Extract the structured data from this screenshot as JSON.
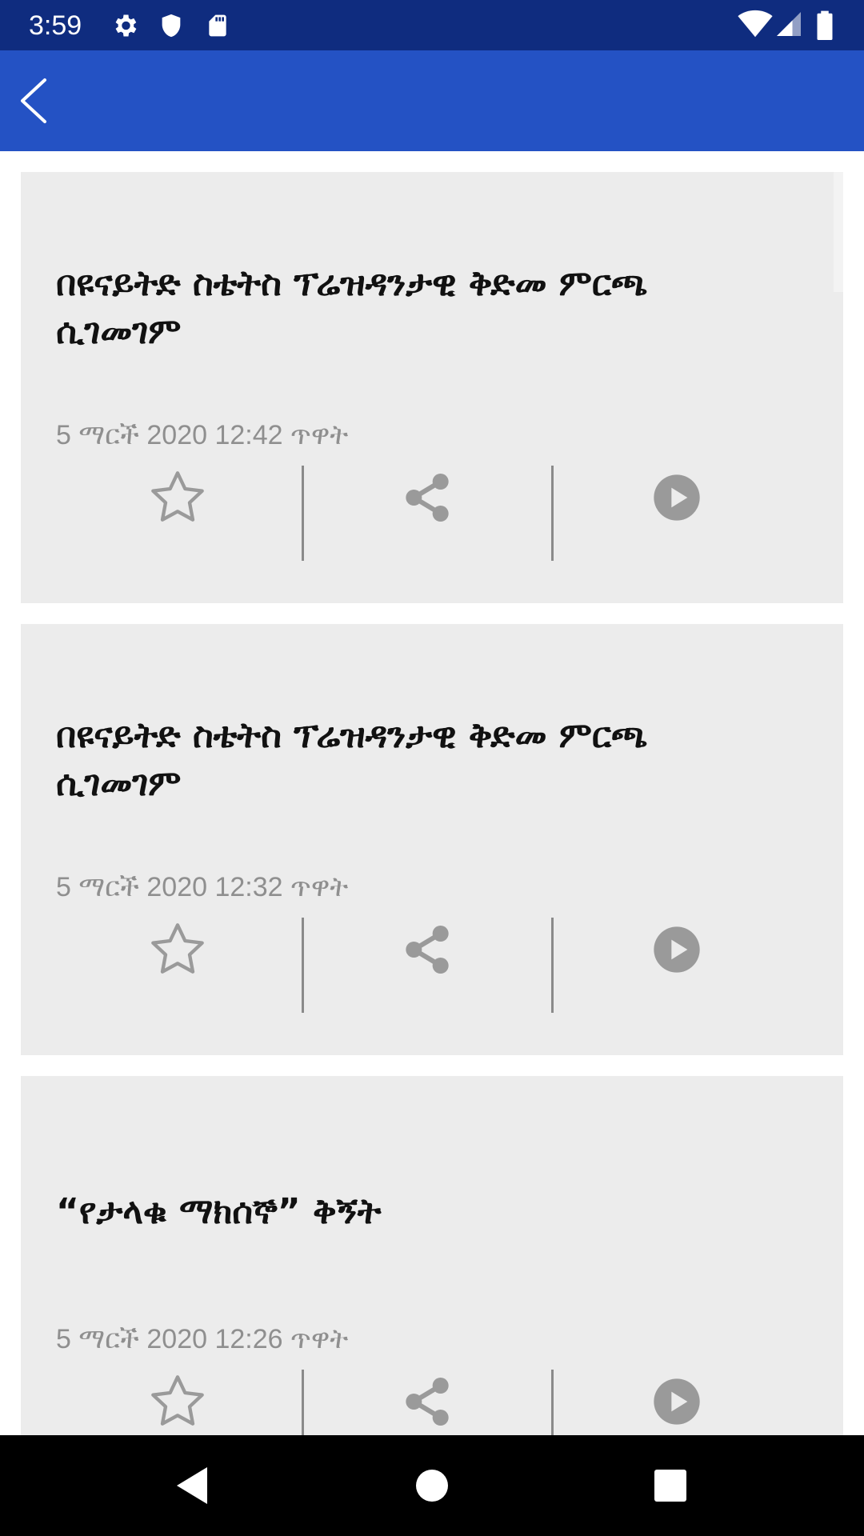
{
  "status_bar": {
    "time": "3:59",
    "left_icons": [
      "gear-icon",
      "shield-icon",
      "sd-card-icon"
    ],
    "right_icons": [
      "wifi-icon",
      "signal-icon",
      "battery-icon"
    ]
  },
  "app_bar": {
    "back_icon": "back-arrow-icon"
  },
  "colors": {
    "status_bar": "#0f2c7f",
    "app_bar": "#2452c4",
    "card_background": "#ececec",
    "icon_gray": "#9a9a9a",
    "title_text": "#111111",
    "date_text": "#8f8f8f"
  },
  "articles": [
    {
      "title": "በዩናይትድ ስቴትስ ፕሬዝዳንታዊ ቅድመ ምርጫ ሲገመገም",
      "date": "5 ማርች 2020 12:42 ጥዋት",
      "actions": [
        "star-icon",
        "share-icon",
        "play-icon"
      ]
    },
    {
      "title": "በዩናይትድ ስቴትስ ፕሬዝዳንታዊ ቅድመ ምርጫ ሲገመገም",
      "date": "5 ማርች 2020 12:32 ጥዋት",
      "actions": [
        "star-icon",
        "share-icon",
        "play-icon"
      ]
    },
    {
      "title": "“የታላቁ ማክሰኞ” ቅኝት",
      "date": "5 ማርች 2020 12:26 ጥዋት",
      "actions": [
        "star-icon",
        "share-icon",
        "play-icon"
      ]
    }
  ],
  "nav_bar": {
    "buttons": [
      "nav-back-icon",
      "nav-home-icon",
      "nav-recents-icon"
    ]
  }
}
